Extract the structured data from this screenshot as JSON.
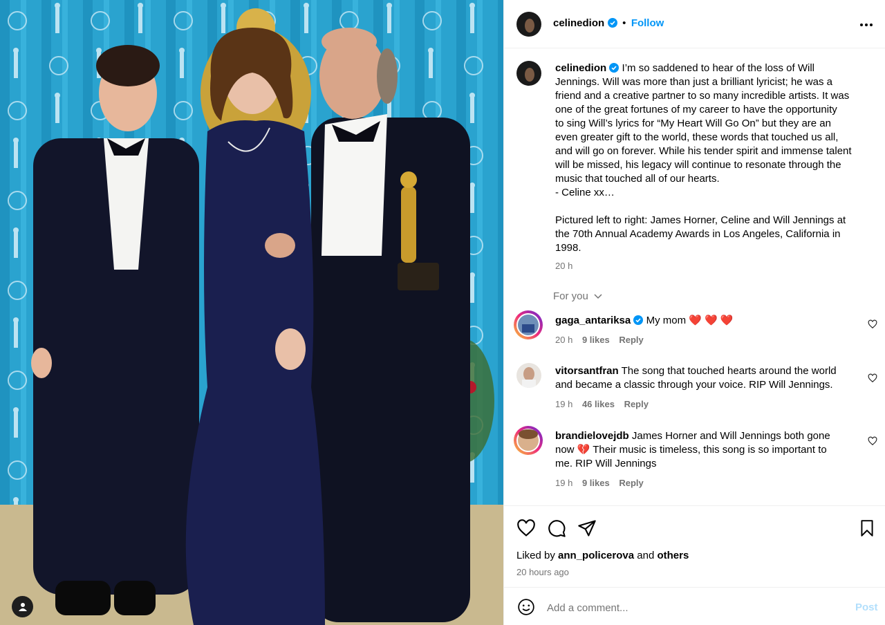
{
  "post": {
    "username": "celinedion",
    "follow_label": "Follow",
    "more_icon": "more-horizontal-icon",
    "caption_lines": [
      "I’m so saddened to hear of the loss of Will",
      "Jennings. Will was more than just a brilliant lyricist; he was a",
      "friend and a creative partner to so many incredible artists. It was",
      "one of the great fortunes of my career to have the opportunity",
      "to sing Will’s lyrics for “My Heart Will Go On” but they are an",
      "even greater gift to the world, these words that touched us all,",
      "and will go on forever. While his tender spirit and immense talent",
      "will be missed, his legacy will continue to resonate through the",
      "music that touched all of our hearts.",
      "- Celine xx…",
      "",
      "Pictured left to right: James Horner, Celine and Will Jennings at",
      "the 70th Annual Academy Awards in Los Angeles, California in",
      "1998."
    ],
    "caption_time": "20 h",
    "for_you_label": "For you"
  },
  "comments": [
    {
      "username": "gaga_antariksa",
      "verified": true,
      "lines": [
        "My mom ❤️ ❤️ ❤️"
      ],
      "time": "20 h",
      "likes": "9 likes",
      "reply": "Reply"
    },
    {
      "username": "vitorsantfran",
      "verified": false,
      "lines": [
        "The song that touched hearts around the world",
        "and became a classic through your voice. RIP Will Jennings."
      ],
      "time": "19 h",
      "likes": "46 likes",
      "reply": "Reply"
    },
    {
      "username": "brandielovejdb",
      "verified": false,
      "lines": [
        "James Horner and Will Jennings both gone",
        "now 💔 Their music is timeless, this song is so important to",
        "me. RIP Will Jennings"
      ],
      "time": "19 h",
      "likes": "9 likes",
      "reply": "Reply"
    }
  ],
  "actions": {
    "liked_by_prefix": "Liked by",
    "liked_by_user": "ann_policerova",
    "liked_by_and": "and",
    "liked_by_others": "others",
    "time_ago": "20 hours ago",
    "icons": [
      "heart-icon",
      "comment-icon",
      "share-icon",
      "bookmark-icon"
    ]
  },
  "add_comment": {
    "placeholder": "Add a comment...",
    "post_label": "Post",
    "emoji_icon": "emoji-icon"
  },
  "colors": {
    "accent": "#0095f6",
    "secondary_text": "#737373",
    "heart_red": "#e0245e",
    "photo_backdrop": "#2aa3cf"
  }
}
